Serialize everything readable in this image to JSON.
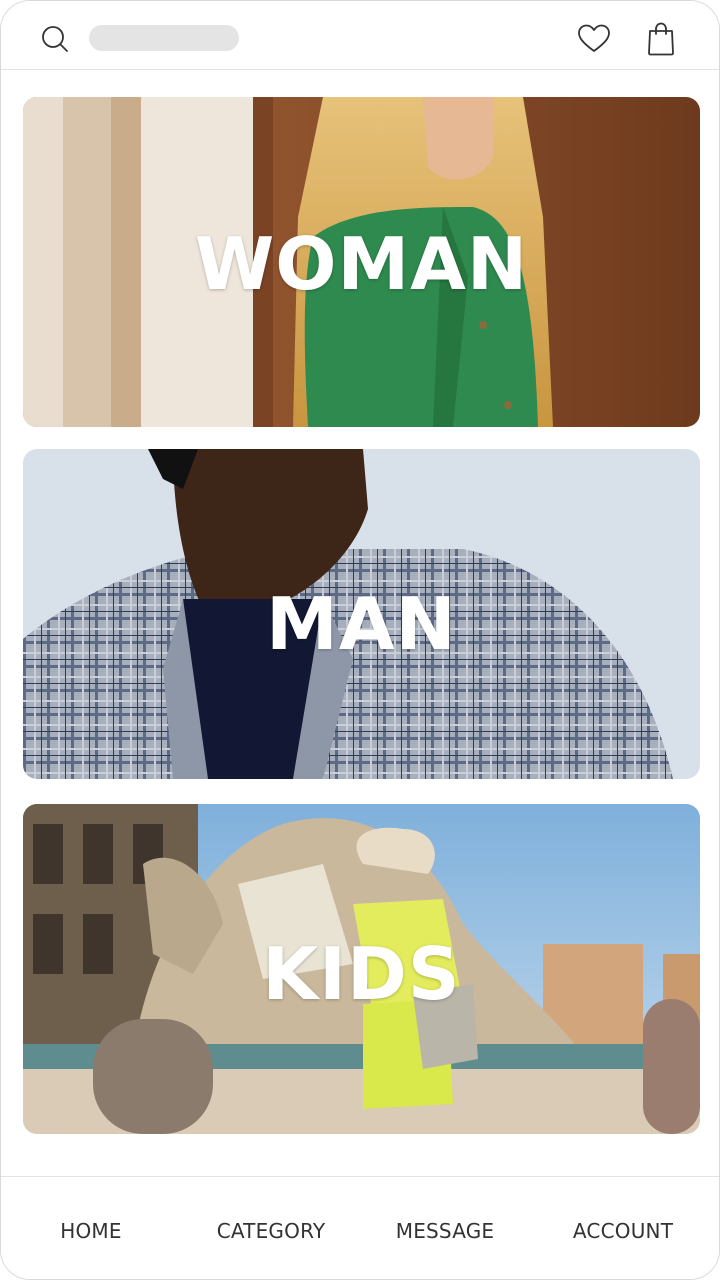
{
  "header": {
    "search_icon": "search-icon",
    "wishlist_icon": "heart-icon",
    "cart_icon": "shopping-bag-icon"
  },
  "categories": [
    {
      "label": "WOMAN"
    },
    {
      "label": "MAN"
    },
    {
      "label": "KIDS"
    }
  ],
  "bottom_nav": {
    "items": [
      {
        "label": "HOME"
      },
      {
        "label": "CATEGORY"
      },
      {
        "label": "MESSAGE"
      },
      {
        "label": "ACCOUNT"
      }
    ]
  },
  "colors": {
    "woman_bg": "#8a4f2b",
    "woman_shirt": "#2f8a4f",
    "man_bg": "#d8e1ea",
    "man_jacket": "#9aa3b2",
    "kids_sky": "#9cc4e4",
    "kids_dress": "#d9e84a"
  }
}
